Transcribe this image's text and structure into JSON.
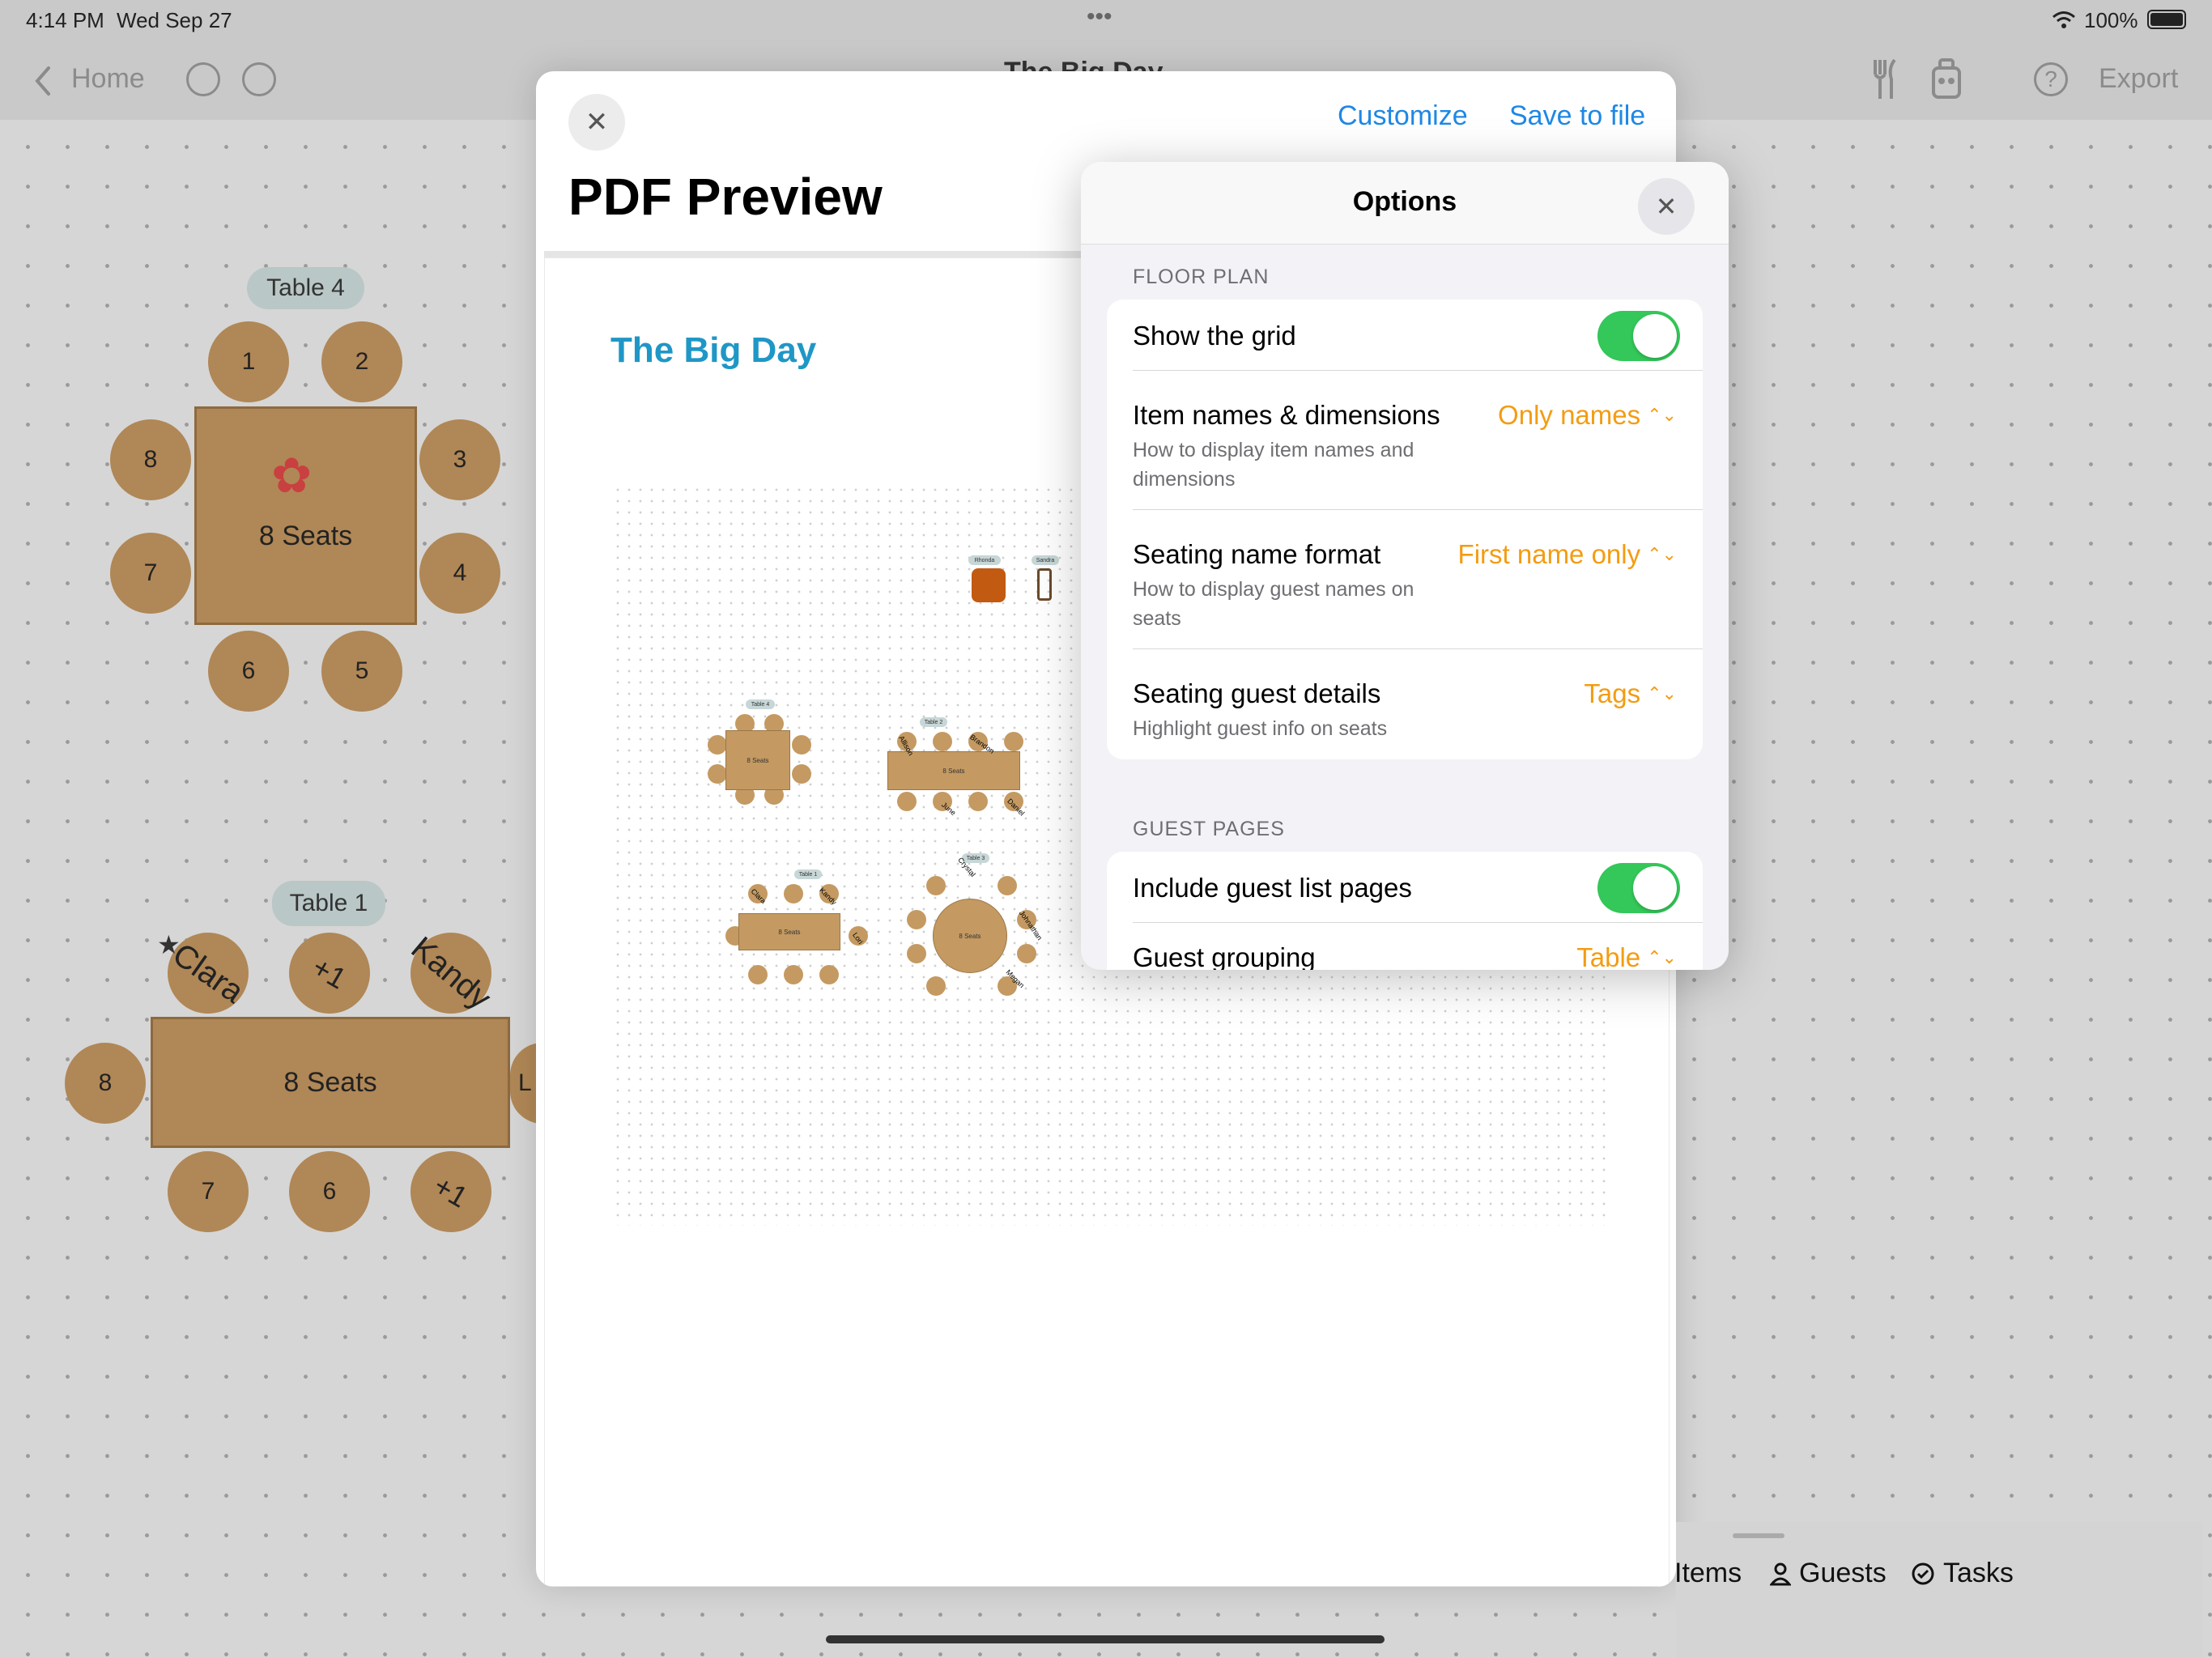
{
  "status_bar": {
    "time": "4:14 PM",
    "date": "Wed Sep 27",
    "dots": "•••",
    "battery": "100%"
  },
  "nav": {
    "back_label": "Home",
    "title": "The Big Day",
    "export_label": "Export",
    "help_glyph": "?"
  },
  "canvas": {
    "table4": {
      "tag": "Table 4",
      "center": "8 Seats",
      "seats": [
        "1",
        "2",
        "3",
        "4",
        "5",
        "6",
        "7",
        "8"
      ]
    },
    "table1": {
      "tag": "Table 1",
      "center": "8 Seats",
      "top_seats": [
        "Clara",
        "+1",
        "Kandy"
      ],
      "left_seat": "8",
      "bottom_seats": [
        "7",
        "6",
        "+1"
      ],
      "right_fragment": "L"
    }
  },
  "sheet": {
    "close_glyph": "✕",
    "customize_label": "Customize",
    "save_label": "Save to file",
    "title": "PDF Preview",
    "page_title": "The Big Day",
    "mini": {
      "rhonda": "Rhonda",
      "sandra": "Sandra",
      "t4": "Table 4",
      "t2": "Table 2",
      "t1": "Table 1",
      "t3": "Table 3",
      "seats8": "8 Seats",
      "names": [
        "Allison",
        "Brandon",
        "June",
        "Daniel",
        "Clara",
        "Kandy",
        "Lori",
        "Crystal",
        "Johnathan",
        "Megan"
      ]
    }
  },
  "options": {
    "title": "Options",
    "close_glyph": "✕",
    "floor_plan_header": "FLOOR PLAN",
    "show_grid": {
      "label": "Show the grid",
      "on": true
    },
    "item_names": {
      "label": "Item names & dimensions",
      "sub": "How to display item names and dimensions",
      "value": "Only names"
    },
    "seating_name": {
      "label": "Seating name format",
      "sub": "How to display guest names on seats",
      "value": "First name only"
    },
    "seating_details": {
      "label": "Seating guest details",
      "sub": "Highlight guest info on seats",
      "value": "Tags"
    },
    "guest_pages_header": "GUEST PAGES",
    "include_guest": {
      "label": "Include guest list pages",
      "on": true
    },
    "guest_grouping": {
      "label": "Guest grouping",
      "value": "Table"
    },
    "accent": "#f39c12",
    "toggle_on": "#34c759"
  },
  "bottom_tabs": {
    "items": "Items",
    "guests": "Guests",
    "tasks": "Tasks"
  }
}
